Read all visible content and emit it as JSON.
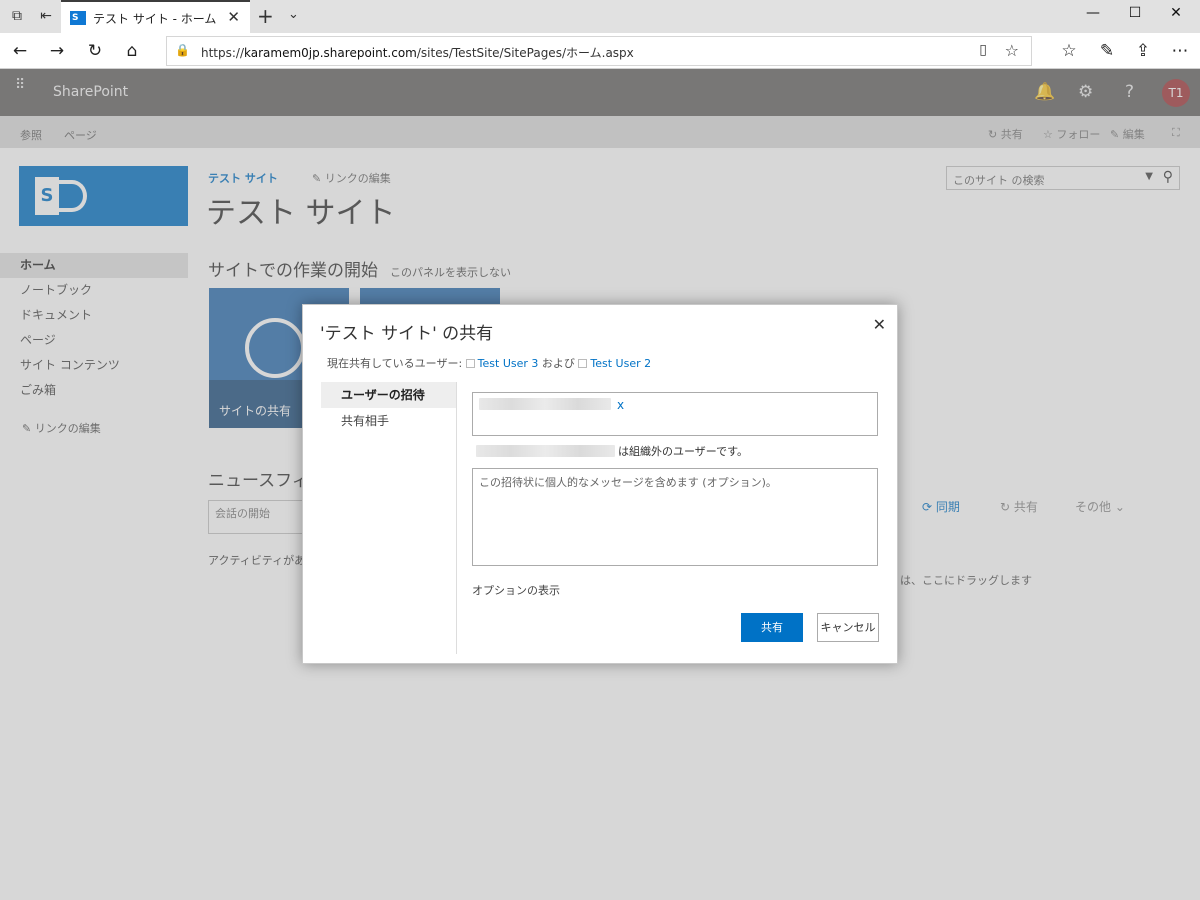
{
  "browser": {
    "tab_title": "テスト サイト - ホーム",
    "url_prefix": "https://",
    "url_host": "karamem0jp.sharepoint.com",
    "url_path": "/sites/TestSite/SitePages/ホーム.aspx",
    "favicon_text": "S"
  },
  "suitebar": {
    "title": "SharePoint",
    "avatar_initials": "T1"
  },
  "ribbon": {
    "tabs": [
      "参照",
      "ページ"
    ],
    "share": "共有",
    "follow": "フォロー",
    "edit": "編集"
  },
  "site": {
    "breadcrumb": "テスト サイト",
    "edit_links": "リンクの編集",
    "title": "テスト サイト",
    "search_placeholder": "このサイト の検索"
  },
  "quicklaunch": {
    "items": [
      "ホーム",
      "ノートブック",
      "ドキュメント",
      "ページ",
      "サイト コンテンツ",
      "ごみ箱"
    ],
    "edit_links": "リンクの編集"
  },
  "main": {
    "getting_started": "サイトでの作業の開始",
    "hide_panel": "このパネルを表示しない",
    "tile_share_label": "サイトの共有",
    "newsfeed": "ニュースフィー",
    "start_conversation": "会話の開始",
    "activity": "アクティビティがありま",
    "sync": "同期",
    "share": "共有",
    "more": "その他",
    "drag_hint": "は、ここにドラッグします"
  },
  "dialog": {
    "title": "'テスト サイト' の共有",
    "shared_with_label": "現在共有しているユーザー:",
    "user_a": "Test User 3",
    "and": "および",
    "user_b": "Test User 2",
    "nav": [
      "ユーザーの招待",
      "共有相手"
    ],
    "invite_remove": "x",
    "external_note": "は組織外のユーザーです。",
    "message_placeholder": "この招待状に個人的なメッセージを含めます (オプション)。",
    "show_options": "オプションの表示",
    "share_button": "共有",
    "cancel_button": "キャンセル"
  },
  "colors": {
    "accent": "#0072c6",
    "suitebar": "#666463",
    "avatar": "#a4373a"
  }
}
